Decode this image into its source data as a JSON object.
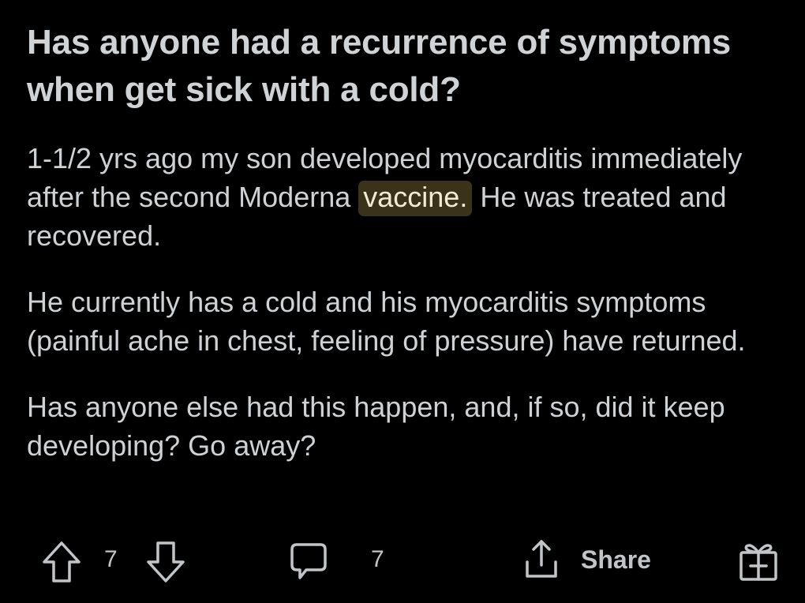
{
  "post": {
    "title": "Has anyone had a recurrence of symptoms when get sick with a cold?",
    "paragraphs": [
      {
        "before": "1-1/2 yrs ago my son developed myocarditis immediately after the second Moderna ",
        "highlight": "vaccine.",
        "after": " He was treated and recovered."
      },
      {
        "text": "He currently has a cold and his myocarditis symptoms (painful ache in chest, feeling of pressure) have returned."
      },
      {
        "text": "Has anyone else had this happen, and, if so, did it keep developing?  Go away?"
      }
    ],
    "highlight_color": "#3b321a"
  },
  "actions": {
    "vote_count": "7",
    "comment_count": "7",
    "share_label": "Share",
    "icons": [
      "upvote-icon",
      "downvote-icon",
      "comment-icon",
      "share-icon",
      "award-icon"
    ]
  }
}
